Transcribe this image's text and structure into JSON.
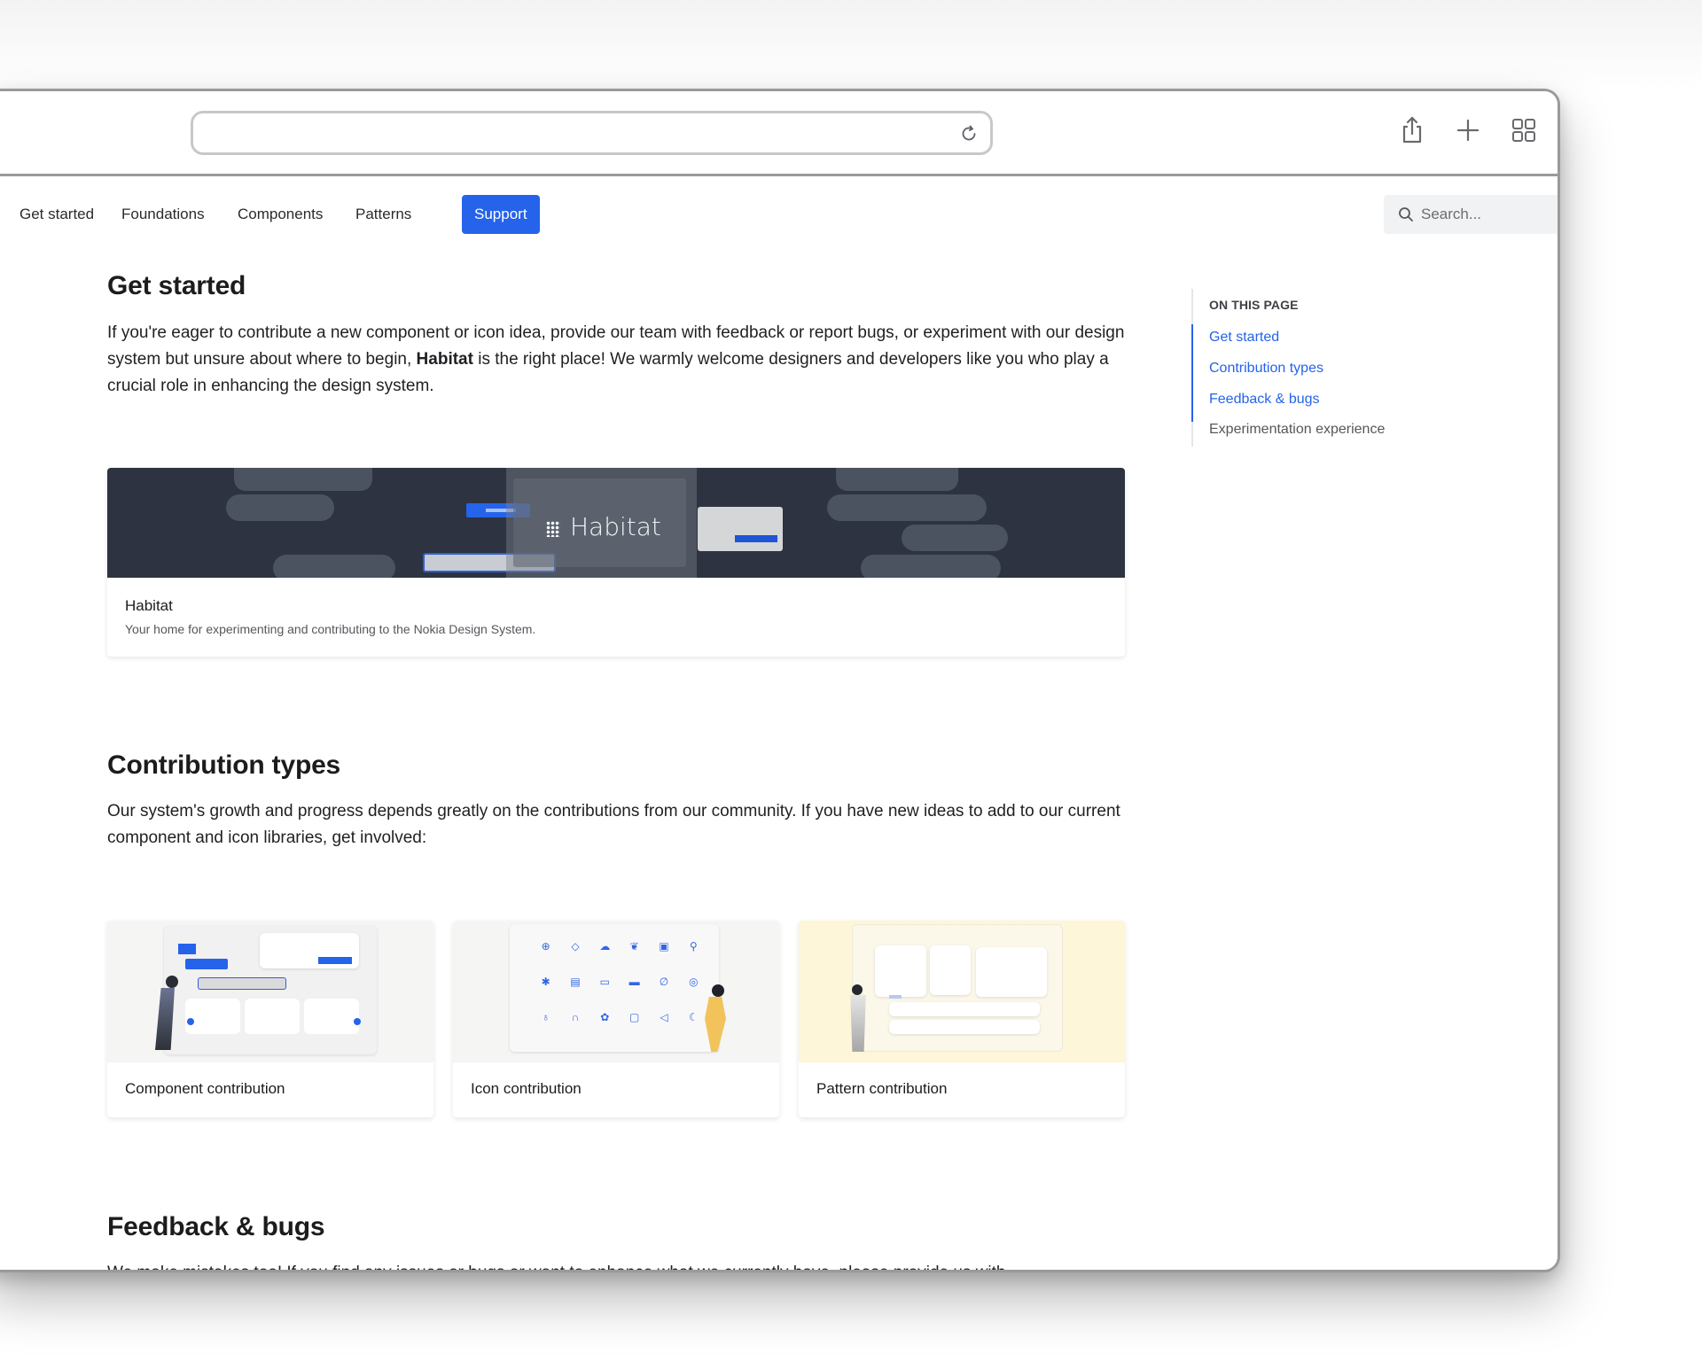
{
  "browser": {
    "url_value": "",
    "reload_icon": "reload-icon",
    "toolbar_icons": [
      "share-icon",
      "plus-icon",
      "tab-overview-icon"
    ]
  },
  "nav": {
    "items": [
      {
        "label": "Get started",
        "active": false
      },
      {
        "label": "Foundations",
        "active": false
      },
      {
        "label": "Components",
        "active": false
      },
      {
        "label": "Patterns",
        "active": false
      },
      {
        "label": "Support",
        "active": true
      }
    ],
    "search_placeholder": "Search...",
    "accent": "#2563eb"
  },
  "sections": {
    "get_started": {
      "title": "Get started",
      "body_before": "If you're eager to contribute a new component or icon idea, provide our team with feedback or report bugs, or experiment with our design system but unsure about where to begin, ",
      "body_bold": "Habitat",
      "body_after": " is the right place! We warmly welcome designers and developers like you who play a crucial role in enhancing the design system."
    },
    "habitat_card": {
      "image_text": "Habitat",
      "title": "Habitat",
      "description": "Your home for experimenting and contributing to the Nokia Design System."
    },
    "contribution_types": {
      "title": "Contribution types",
      "body": "Our system's growth and progress depends greatly on the contributions from our community. If you have new ideas to add to our current component and icon libraries, get involved:",
      "cards": [
        {
          "label": "Component contribution"
        },
        {
          "label": "Icon contribution"
        },
        {
          "label": "Pattern contribution"
        }
      ]
    },
    "feedback": {
      "title": "Feedback & bugs",
      "body": "We make mistakes too! If you find any issues or bugs or want to enhance what we currently have, please provide us with"
    }
  },
  "toc": {
    "heading": "ON THIS PAGE",
    "links": [
      {
        "label": "Get started",
        "active": true
      },
      {
        "label": "Contribution types",
        "active": true
      },
      {
        "label": "Feedback & bugs",
        "active": true
      },
      {
        "label": "Experimentation experience",
        "active": false
      }
    ]
  }
}
